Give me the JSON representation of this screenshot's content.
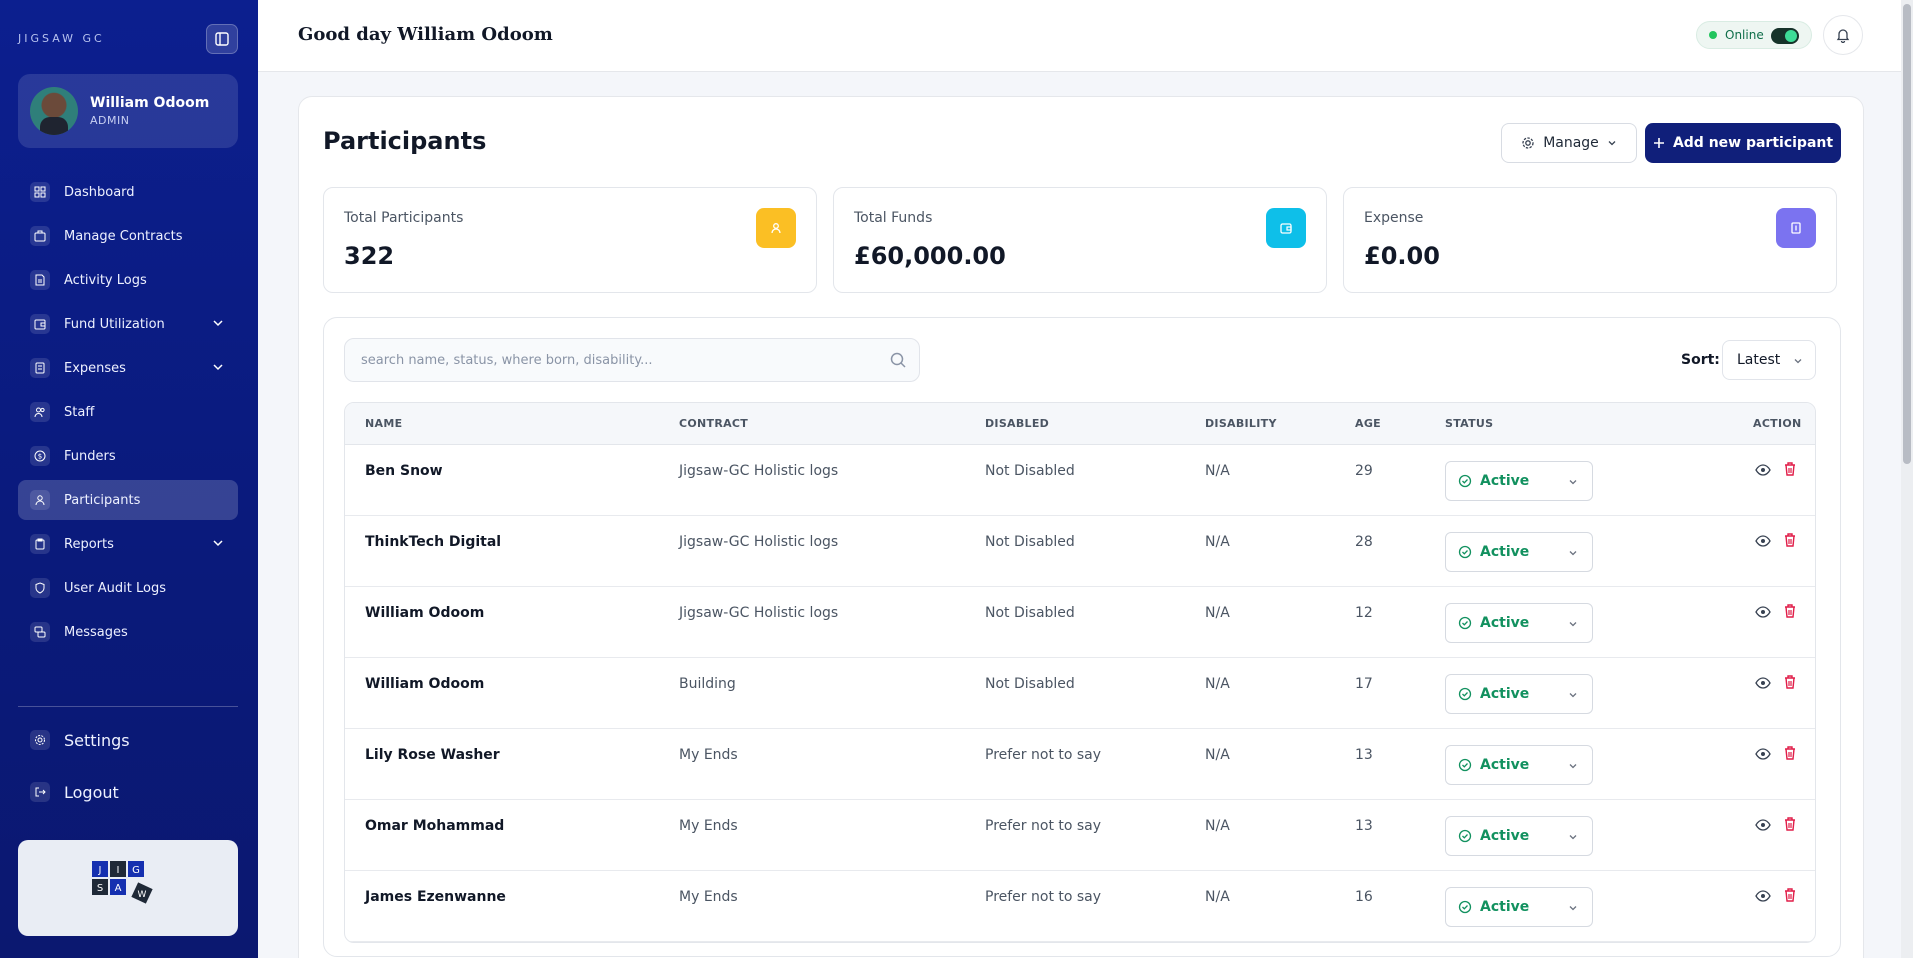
{
  "sidebar": {
    "brand": "JIGSAW GC",
    "profile": {
      "name": "William Odoom",
      "role": "ADMIN"
    },
    "items": [
      {
        "label": "Dashboard",
        "icon": "dashboard-icon",
        "active": false,
        "has_chevron": false
      },
      {
        "label": "Manage Contracts",
        "icon": "briefcase-icon",
        "active": false,
        "has_chevron": false
      },
      {
        "label": "Activity Logs",
        "icon": "document-icon",
        "active": false,
        "has_chevron": false
      },
      {
        "label": "Fund Utilization",
        "icon": "wallet-icon",
        "active": false,
        "has_chevron": true
      },
      {
        "label": "Expenses",
        "icon": "receipt-icon",
        "active": false,
        "has_chevron": true
      },
      {
        "label": "Staff",
        "icon": "users-icon",
        "active": false,
        "has_chevron": false
      },
      {
        "label": "Funders",
        "icon": "dollar-icon",
        "active": false,
        "has_chevron": false
      },
      {
        "label": "Participants",
        "icon": "user-icon",
        "active": true,
        "has_chevron": false
      },
      {
        "label": "Reports",
        "icon": "clipboard-icon",
        "active": false,
        "has_chevron": true
      },
      {
        "label": "User Audit Logs",
        "icon": "shield-icon",
        "active": false,
        "has_chevron": false
      },
      {
        "label": "Messages",
        "icon": "chat-icon",
        "active": false,
        "has_chevron": false
      }
    ],
    "settings_label": "Settings",
    "logout_label": "Logout",
    "logo_letters": [
      "J",
      "I",
      "G",
      "S",
      "A",
      "W"
    ]
  },
  "header": {
    "greeting": "Good day William Odoom",
    "online_label": "Online"
  },
  "page": {
    "title": "Participants",
    "manage_label": "Manage",
    "add_label": "Add new participant"
  },
  "stats": [
    {
      "label": "Total Participants",
      "value": "322",
      "icon": "user-icon",
      "color": "#fbbf24"
    },
    {
      "label": "Total Funds",
      "value": "£60,000.00",
      "icon": "wallet-icon",
      "color": "#0ebfe9"
    },
    {
      "label": "Expense",
      "value": "£0.00",
      "icon": "receipt-icon",
      "color": "#7b73f0"
    }
  ],
  "search": {
    "placeholder": "search name, status, where born, disability..."
  },
  "sort": {
    "label": "Sort:",
    "value": "Latest"
  },
  "table": {
    "headers": [
      "NAME",
      "CONTRACT",
      "DISABLED",
      "DISABILITY",
      "AGE",
      "STATUS",
      "ACTION"
    ],
    "rows": [
      {
        "name": "Ben Snow",
        "contract": "Jigsaw-GC Holistic logs",
        "disabled": "Not Disabled",
        "disability": "N/A",
        "age": "29",
        "status": "Active"
      },
      {
        "name": "ThinkTech Digital",
        "contract": "Jigsaw-GC Holistic logs",
        "disabled": "Not Disabled",
        "disability": "N/A",
        "age": "28",
        "status": "Active"
      },
      {
        "name": "William Odoom",
        "contract": "Jigsaw-GC Holistic logs",
        "disabled": "Not Disabled",
        "disability": "N/A",
        "age": "12",
        "status": "Active"
      },
      {
        "name": "William Odoom",
        "contract": "Building",
        "disabled": "Not Disabled",
        "disability": "N/A",
        "age": "17",
        "status": "Active"
      },
      {
        "name": "Lily Rose Washer",
        "contract": "My Ends",
        "disabled": "Prefer not to say",
        "disability": "N/A",
        "age": "13",
        "status": "Active"
      },
      {
        "name": "Omar Mohammad",
        "contract": "My Ends",
        "disabled": "Prefer not to say",
        "disability": "N/A",
        "age": "13",
        "status": "Active"
      },
      {
        "name": "James Ezenwanne",
        "contract": "My Ends",
        "disabled": "Prefer not to say",
        "disability": "N/A",
        "age": "16",
        "status": "Active"
      }
    ]
  },
  "colors": {
    "sidebar": "#0c1f8f",
    "primary_button": "#101f7a",
    "status_active": "#12915f",
    "delete": "#e11d48"
  }
}
